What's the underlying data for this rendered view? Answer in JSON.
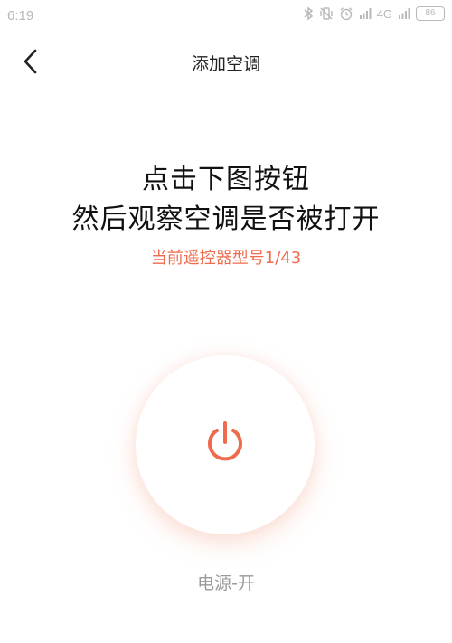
{
  "status_bar": {
    "time": "6:19",
    "network": "4G",
    "battery": "86",
    "icons": [
      "bluetooth-icon",
      "vibrate-icon",
      "alarm-icon",
      "signal-icon",
      "signal-icon-2"
    ]
  },
  "header": {
    "back_icon": "chevron-left-icon",
    "title": "添加空调"
  },
  "instructions": {
    "line1": "点击下图按钮",
    "line2": "然后观察空调是否被打开",
    "model_count": "当前遥控器型号1/43"
  },
  "power": {
    "icon": "power-icon",
    "caption": "电源-开"
  },
  "colors": {
    "accent": "#ef6b4e",
    "title_text": "#222222",
    "caption_text": "#9a9a9a",
    "status_text": "#b8b8b8"
  }
}
